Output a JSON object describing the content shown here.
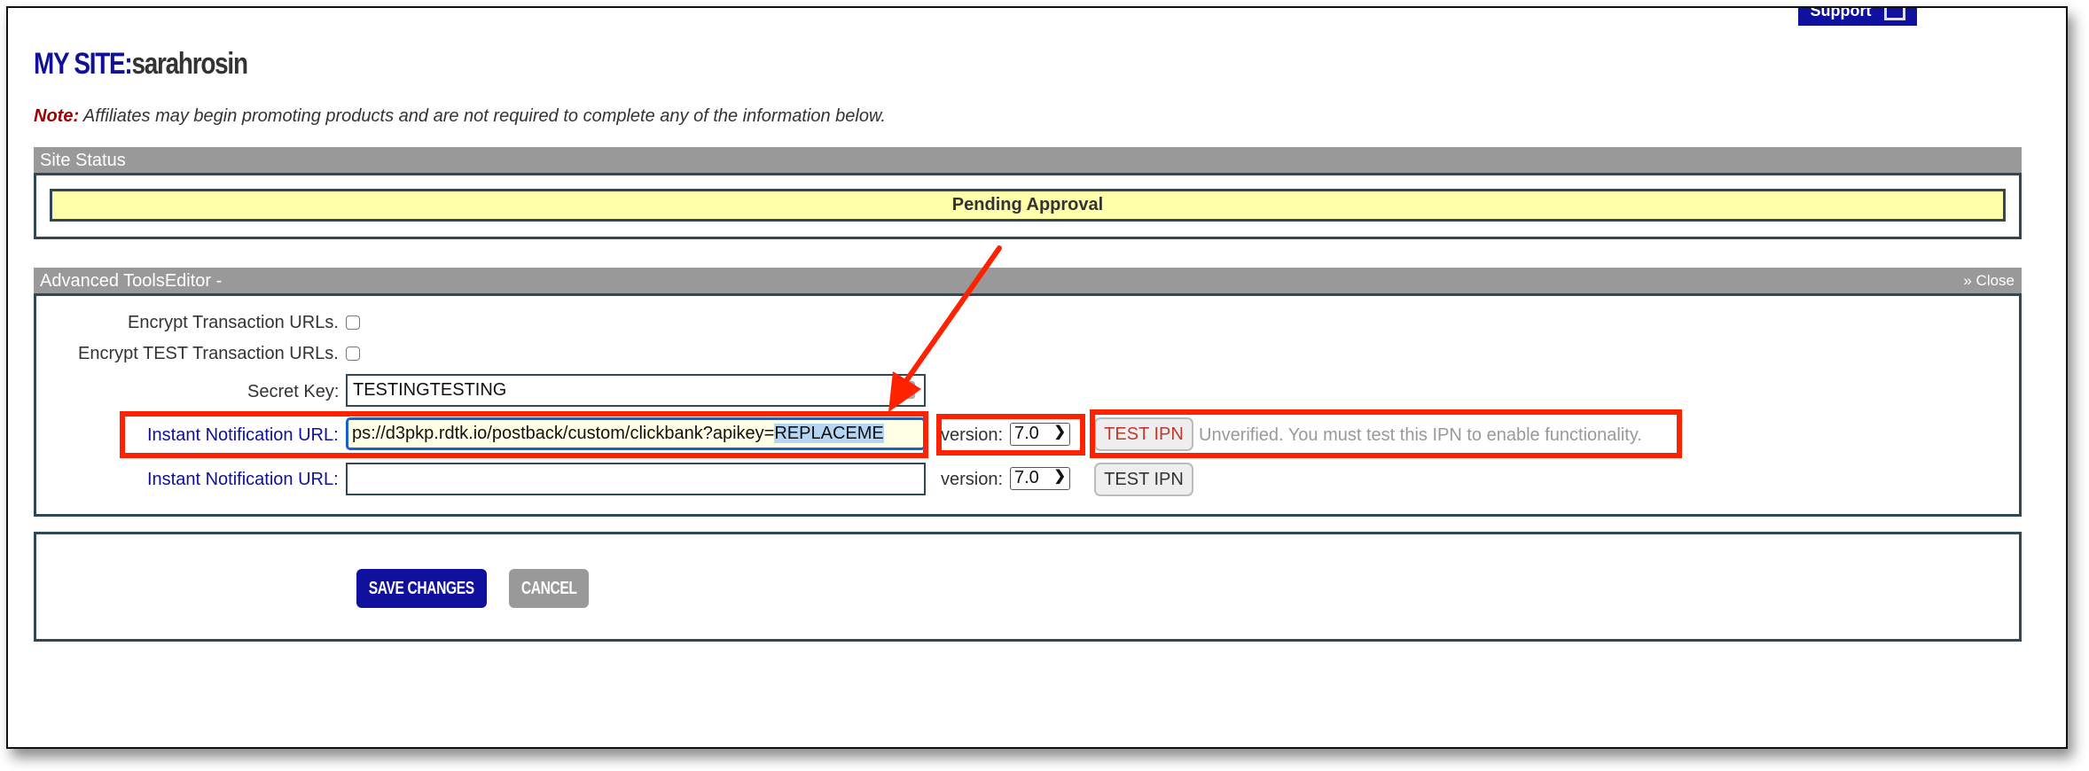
{
  "header": {
    "support_label": "Support",
    "title_prefix": "MY SITE:",
    "title_user": "sarahrosin"
  },
  "note": {
    "label": "Note:",
    "text": " Affiliates may begin promoting products and are not required to complete any of the information below."
  },
  "site_status": {
    "heading": "Site Status",
    "status": "Pending Approval"
  },
  "advanced_tools": {
    "heading": "Advanced ToolsEditor -",
    "close_label": "» Close",
    "encrypt_label": "Encrypt Transaction URLs.",
    "encrypt_checked": false,
    "encrypt_test_label": "Encrypt TEST Transaction URLs.",
    "encrypt_test_checked": false,
    "secret_key_label": "Secret Key:",
    "secret_key_value": "TESTINGTESTING",
    "ipn_rows": [
      {
        "label": "Instant Notification URL:",
        "value_prefix": "ps://d3pkp.rdtk.io/postback/custom/clickbank?apikey=",
        "value_selected": "REPLACEME",
        "version_label": "version:",
        "version_value": "7.0",
        "test_label": "TEST IPN",
        "status_text": "Unverified. You must test this IPN to enable functionality."
      },
      {
        "label": "Instant Notification URL:",
        "value": "",
        "version_label": "version:",
        "version_value": "7.0",
        "test_label": "TEST IPN"
      }
    ]
  },
  "actions": {
    "save_label": "SAVE CHANGES",
    "cancel_label": "CANCEL"
  },
  "colors": {
    "brand_blue": "#10109e",
    "annotation_red": "#ff2200",
    "status_yellow": "#ffffaa",
    "panel_gray": "#999999"
  }
}
